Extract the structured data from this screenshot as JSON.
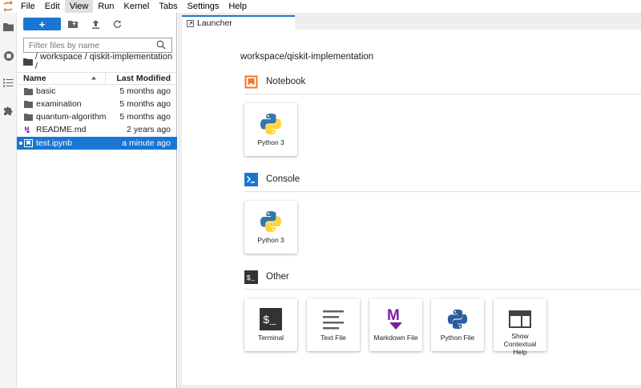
{
  "menubar": {
    "items": [
      "File",
      "Edit",
      "View",
      "Run",
      "Kernel",
      "Tabs",
      "Settings",
      "Help"
    ],
    "active_index": 2
  },
  "activity_bar": {
    "icons": [
      "folder-icon",
      "running-icon",
      "toc-icon",
      "extension-icon"
    ]
  },
  "file_browser": {
    "new_button_label": "+",
    "filter_placeholder": "Filter files by name",
    "breadcrumb": "/ workspace / qiskit-implementation /",
    "header_name": "Name",
    "header_modified": "Last Modified",
    "files": [
      {
        "name": "basic",
        "modified": "5 months ago",
        "type": "folder"
      },
      {
        "name": "examination",
        "modified": "5 months ago",
        "type": "folder"
      },
      {
        "name": "quantum-algorithm",
        "modified": "5 months ago",
        "type": "folder"
      },
      {
        "name": "README.md",
        "modified": "2 years ago",
        "type": "markdown"
      },
      {
        "name": "test.ipynb",
        "modified": "a minute ago",
        "type": "notebook",
        "selected": true
      }
    ]
  },
  "tabs": [
    {
      "label": "Launcher",
      "active": true
    }
  ],
  "launcher": {
    "cwd": "workspace/qiskit-implementation",
    "sections": [
      {
        "title": "Notebook",
        "cards": [
          "Python 3"
        ]
      },
      {
        "title": "Console",
        "cards": [
          "Python 3"
        ]
      },
      {
        "title": "Other",
        "cards": [
          "Terminal",
          "Text File",
          "Markdown File",
          "Python File",
          "Show Contextual Help"
        ]
      }
    ]
  },
  "colors": {
    "accent": "#1976d2",
    "notebook_icon": "#f37726",
    "console_icon": "#1976d2",
    "markdown_icon": "#7b1fa2",
    "python_blue": "#3776ab",
    "python_yellow": "#ffd43b"
  }
}
